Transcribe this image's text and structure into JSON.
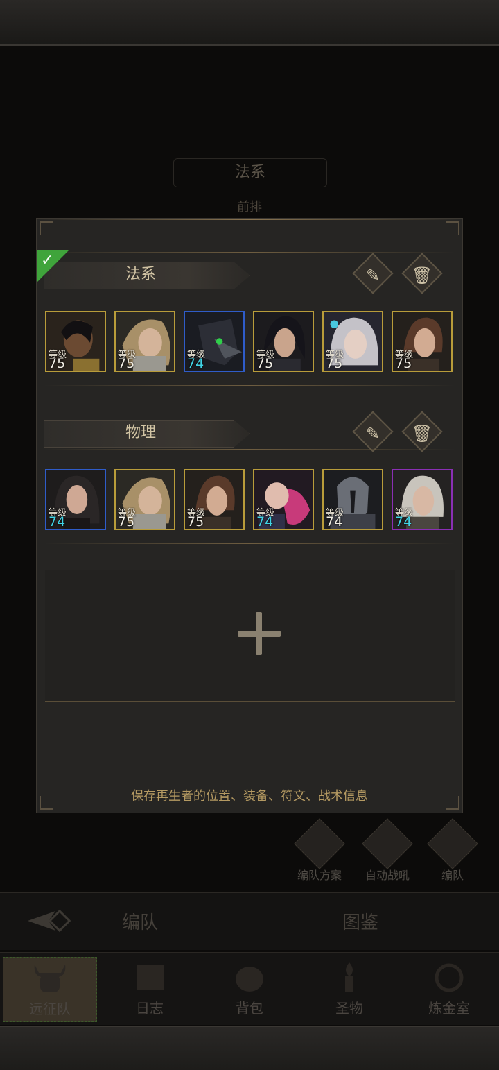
{
  "background": {
    "title": "法系",
    "subtitle": "前排"
  },
  "panel": {
    "teams": [
      {
        "name": "法系",
        "selected": true,
        "heroes": [
          {
            "level_label": "等级",
            "level": "75",
            "frame": "gold",
            "level_color": "white"
          },
          {
            "level_label": "等级",
            "level": "75",
            "frame": "gold",
            "level_color": "white"
          },
          {
            "level_label": "等级",
            "level": "74",
            "frame": "blue",
            "level_color": "cyan"
          },
          {
            "level_label": "等级",
            "level": "75",
            "frame": "gold",
            "level_color": "white"
          },
          {
            "level_label": "等级",
            "level": "75",
            "frame": "gold",
            "level_color": "white"
          },
          {
            "level_label": "等级",
            "level": "75",
            "frame": "gold",
            "level_color": "white"
          }
        ]
      },
      {
        "name": "物理",
        "selected": false,
        "heroes": [
          {
            "level_label": "等级",
            "level": "74",
            "frame": "blue",
            "level_color": "cyan"
          },
          {
            "level_label": "等级",
            "level": "75",
            "frame": "gold",
            "level_color": "white"
          },
          {
            "level_label": "等级",
            "level": "75",
            "frame": "gold",
            "level_color": "white"
          },
          {
            "level_label": "等级",
            "level": "74",
            "frame": "gold",
            "level_color": "cyan"
          },
          {
            "level_label": "等级",
            "level": "74",
            "frame": "gold",
            "level_color": "white"
          },
          {
            "level_label": "等级",
            "level": "74",
            "frame": "purple",
            "level_color": "cyan"
          }
        ]
      }
    ],
    "tip": "保存再生者的位置、装备、符文、战术信息"
  },
  "side_buttons": [
    {
      "label": "编队方案",
      "icon": "helmet-icon"
    },
    {
      "label": "自动战吼",
      "icon": "auto-icon"
    },
    {
      "label": "编队",
      "icon": "grid-icon"
    }
  ],
  "tabs": {
    "formation": "编队",
    "codex": "图鉴"
  },
  "nav": [
    {
      "label": "远征队",
      "icon": "viking-helmet-icon",
      "active": true
    },
    {
      "label": "日志",
      "icon": "scroll-icon",
      "active": false
    },
    {
      "label": "背包",
      "icon": "bag-icon",
      "active": false
    },
    {
      "label": "圣物",
      "icon": "torch-icon",
      "active": false
    },
    {
      "label": "炼金室",
      "icon": "alchemy-icon",
      "active": false
    }
  ],
  "colors": {
    "gold_frame": "#b89c3a",
    "blue_frame": "#2f5cc8",
    "purple_frame": "#8a2fb4",
    "cyan_level": "#40d4e6",
    "selected_check": "#3fa43b"
  }
}
